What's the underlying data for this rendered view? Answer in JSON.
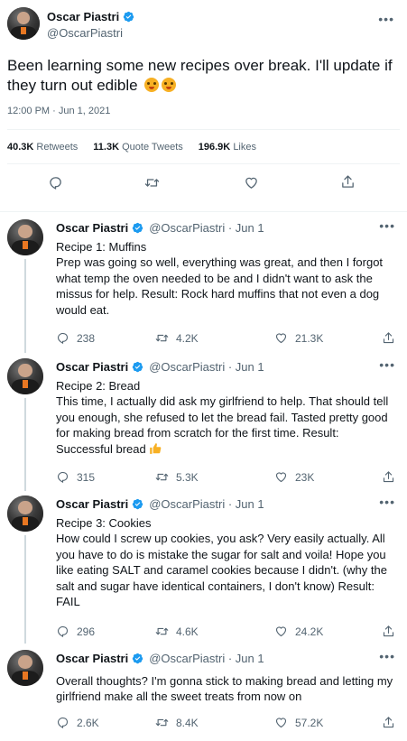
{
  "main_tweet": {
    "name": "Oscar Piastri",
    "handle": "@OscarPiastri",
    "text": "Been learning some new recipes over break. I'll update if they turn out edible",
    "timestamp": "12:00 PM · Jun 1, 2021",
    "stats": {
      "retweets_count": "40.3K",
      "retweets_label": "Retweets",
      "quotes_count": "11.3K",
      "quotes_label": "Quote Tweets",
      "likes_count": "196.9K",
      "likes_label": "Likes"
    },
    "icons": [
      "more-icon",
      "reply-icon",
      "retweet-icon",
      "like-icon",
      "share-icon",
      "verified-badge",
      "emoji"
    ]
  },
  "replies": [
    {
      "name": "Oscar Piastri",
      "handle_date": "@OscarPiastri · Jun 1",
      "text": "Recipe 1: Muffins\nPrep was going so well, everything was great, and then I forgot what temp the oven needed to be and I didn't want to ask the missus for help. Result: Rock hard muffins that not even a dog would eat.",
      "replies_count": "238",
      "retweets_count": "4.2K",
      "likes_count": "21.3K"
    },
    {
      "name": "Oscar Piastri",
      "handle_date": "@OscarPiastri · Jun 1",
      "text": "Recipe 2: Bread\nThis time, I actually did ask my girlfriend to help. That should tell you enough, she refused to let the bread fail. Tasted pretty good for making bread from scratch for the first time. Result: Successful bread",
      "replies_count": "315",
      "retweets_count": "5.3K",
      "likes_count": "23K"
    },
    {
      "name": "Oscar Piastri",
      "handle_date": "@OscarPiastri · Jun 1",
      "text": "Recipe 3: Cookies\nHow could I screw up cookies, you ask? Very easily actually. All you have to do is mistake the sugar for salt and voila! Hope you like eating SALT and caramel cookies because I didn't. (why the salt and sugar have identical containers, I don't know) Result: FAIL",
      "replies_count": "296",
      "retweets_count": "4.6K",
      "likes_count": "24.2K"
    },
    {
      "name": "Oscar Piastri",
      "handle_date": "@OscarPiastri · Jun 1",
      "text": "Overall thoughts? I'm gonna stick to making bread and letting my girlfriend make all the sweet treats from now on",
      "replies_count": "2.6K",
      "retweets_count": "8.4K",
      "likes_count": "57.2K"
    }
  ],
  "colors": {
    "text": "#0f1419",
    "secondary": "#536471",
    "verified": "#1d9bf0",
    "divider": "#eff3f4",
    "thread_line": "#cfd9de"
  }
}
